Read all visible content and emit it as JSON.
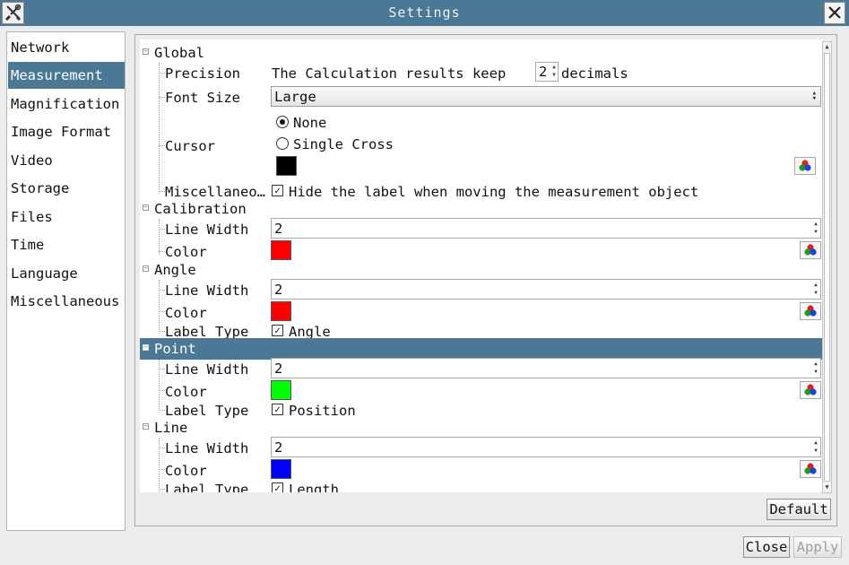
{
  "window": {
    "title": "Settings",
    "app_icon": "tools-icon",
    "close_icon": "close-icon"
  },
  "nav": {
    "items": [
      {
        "label": "Network"
      },
      {
        "label": "Measurement"
      },
      {
        "label": "Magnification"
      },
      {
        "label": "Image Format"
      },
      {
        "label": "Video"
      },
      {
        "label": "Storage"
      },
      {
        "label": "Files"
      },
      {
        "label": "Time"
      },
      {
        "label": "Language"
      },
      {
        "label": "Miscellaneous"
      }
    ],
    "selected": "Measurement"
  },
  "tree": {
    "global": {
      "label": "Global",
      "precision": {
        "label": "Precision",
        "prefix": "The Calculation results keep",
        "value": "2",
        "suffix": "decimals"
      },
      "font_size": {
        "label": "Font Size",
        "value": "Large"
      },
      "cursor": {
        "label": "Cursor",
        "options": [
          "None",
          "Single Cross"
        ],
        "selected": "None",
        "color": "#000000"
      },
      "misc": {
        "label": "Miscellaneo…",
        "checkbox_label": "Hide the label when moving the measurement object",
        "checked": true
      }
    },
    "calibration": {
      "label": "Calibration",
      "line_width_label": "Line Width",
      "line_width": "2",
      "color_label": "Color",
      "color": "#ff0000"
    },
    "angle": {
      "label": "Angle",
      "line_width_label": "Line Width",
      "line_width": "2",
      "color_label": "Color",
      "color": "#ff0000",
      "label_type_label": "Label Type",
      "label_type": "Angle",
      "label_type_checked": true
    },
    "point": {
      "label": "Point",
      "line_width_label": "Line Width",
      "line_width": "2",
      "color_label": "Color",
      "color": "#00ff00",
      "label_type_label": "Label Type",
      "label_type": "Position",
      "label_type_checked": true
    },
    "line": {
      "label": "Line",
      "line_width_label": "Line Width",
      "line_width": "2",
      "color_label": "Color",
      "color": "#0000ff",
      "label_type_label": "Label Type",
      "label_type": "Length",
      "label_type_checked": true
    }
  },
  "buttons": {
    "default": "Default",
    "close": "Close",
    "apply": "Apply"
  },
  "colors": {
    "accent": "#4a7895",
    "title_text": "#f2f2f2"
  }
}
